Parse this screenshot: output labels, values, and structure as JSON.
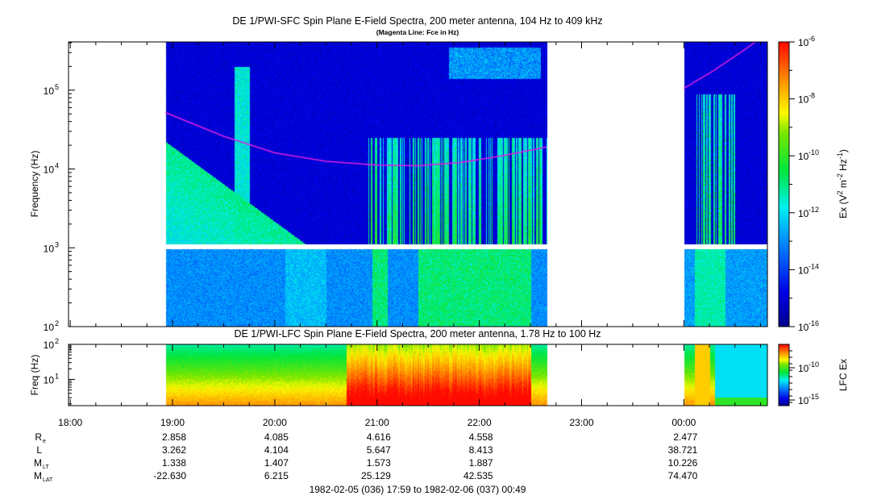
{
  "chart_data": [
    {
      "type": "heatmap",
      "title": "DE 1/PWI-SFC  Spin Plane E-Field Spectra, 200 meter antenna, 104 Hz to 409 kHz",
      "subtitle": "(Magenta Line: Fce in Hz)",
      "ylabel": "Frequency (Hz)",
      "yscale": "log",
      "ylim": [
        100,
        409000
      ],
      "yticks": [
        {
          "value": 100,
          "label": "10",
          "exp": "2"
        },
        {
          "value": 1000,
          "label": "10",
          "exp": "3"
        },
        {
          "value": 10000,
          "label": "10",
          "exp": "4"
        },
        {
          "value": 100000,
          "label": "10",
          "exp": "5"
        }
      ],
      "data_intervals_hours": [
        [
          18.93,
          22.66
        ],
        [
          24.0,
          24.82
        ]
      ],
      "fce_line": {
        "color": "#e020e0",
        "points_hours_hz": [
          [
            18.93,
            52000
          ],
          [
            19.5,
            26000
          ],
          [
            20.0,
            16000
          ],
          [
            20.5,
            12500
          ],
          [
            21.0,
            11200
          ],
          [
            21.4,
            11000
          ],
          [
            21.8,
            12000
          ],
          [
            22.2,
            14500
          ],
          [
            22.66,
            19000
          ],
          [
            24.0,
            105000
          ],
          [
            24.3,
            180000
          ],
          [
            24.6,
            330000
          ],
          [
            24.7,
            409000
          ]
        ]
      },
      "colorbar": {
        "label": "Ex (V",
        "label_full": "Ex (V2 m-2 Hz-1)",
        "range_log10": [
          -16,
          -6
        ],
        "ticks": [
          {
            "label": "10",
            "exp": "-6"
          },
          {
            "label": "10",
            "exp": "-8"
          },
          {
            "label": "10",
            "exp": "-10"
          },
          {
            "label": "10",
            "exp": "-12"
          },
          {
            "label": "10",
            "exp": "-14"
          },
          {
            "label": "10",
            "exp": "-16"
          }
        ]
      }
    },
    {
      "type": "heatmap",
      "title": "DE 1/PWI-LFC  Spin Plane E-Field Spectra, 200 meter antenna, 1.78 Hz to 100 Hz",
      "ylabel": "Freq (Hz)",
      "yscale": "log",
      "ylim": [
        1.78,
        100
      ],
      "yticks": [
        {
          "value": 100,
          "label": "10",
          "exp": "2"
        },
        {
          "value": 10,
          "label": "10",
          "exp": "1"
        }
      ],
      "data_intervals_hours": [
        [
          18.93,
          22.66
        ],
        [
          24.0,
          24.82
        ]
      ],
      "colorbar": {
        "label": "LFC Ex",
        "range_log10": [
          -17,
          -7
        ],
        "ticks": [
          {
            "label": "10",
            "exp": "-10"
          },
          {
            "label": "10",
            "exp": "-15"
          }
        ]
      }
    }
  ],
  "xaxis": {
    "ticks": [
      "18:00",
      "19:00",
      "20:00",
      "21:00",
      "22:00",
      "23:00",
      "00:00"
    ],
    "tick_hours": [
      18,
      19,
      20,
      21,
      22,
      23,
      24
    ],
    "range_hours": [
      17.983,
      24.817
    ]
  },
  "ephemeris": {
    "rows": [
      {
        "label": "R",
        "sub": "e",
        "values": [
          "2.858",
          "4.085",
          "4.616",
          "4.558",
          "",
          "2.477"
        ]
      },
      {
        "label": "L",
        "sub": "",
        "values": [
          "3.262",
          "4.104",
          "5.647",
          "8.413",
          "",
          "38.721"
        ]
      },
      {
        "label": "M",
        "sub": "LT",
        "values": [
          "1.338",
          "1.407",
          "1.573",
          "1.887",
          "",
          "10.226"
        ]
      },
      {
        "label": "M",
        "sub": "LAT",
        "values": [
          "-22.630",
          "6.215",
          "25.129",
          "42.535",
          "",
          "74.470"
        ]
      }
    ],
    "value_hours": [
      19,
      20,
      21,
      22,
      23,
      24
    ]
  },
  "time_range": "1982-02-05 (036) 17:59 to 1982-02-06 (037) 00:49"
}
